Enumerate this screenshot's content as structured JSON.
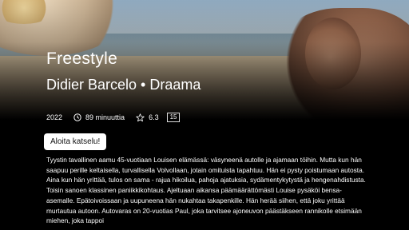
{
  "movie": {
    "title": "Freestyle",
    "director": "Didier Barcelo",
    "separator": "•",
    "genre": "Draama",
    "year": "2022",
    "duration": "89 minuuttia",
    "rating": "6.3",
    "age_rating": "15",
    "play_label": "Aloita katselu!",
    "description": "Tyystin tavallinen aamu 45-vuotiaan Louisen elämässä: väsyneenä autolle ja ajamaan töihin. Mutta kun hän saapuu perille keltaisella, turvallisella Volvollaan, jotain omituista tapahtuu. Hän ei pysty poistumaan autosta. Aina kun hän yrittää, tulos on sama - rajua hikoilua, pahoja ajatuksia, sydämentykytystä ja hengenahdistusta. Toisin sanoen klassinen paniikkikohtaus. Ajeltuaan aikansa päämäärättömästi Louise pysäköi bensa-asemalle. Epätoivoissaan ja uupuneena hän nukahtaa takapenkille. Hän herää siihen, että joku yrittää murtautua autoon. Autovaras on 20-vuotias Paul, joka tarvitsee ajoneuvon päästäkseen rannikolle etsimään miehen, joka tappoi"
  },
  "icons": {
    "duration": "clock-icon",
    "rating": "star-icon"
  }
}
